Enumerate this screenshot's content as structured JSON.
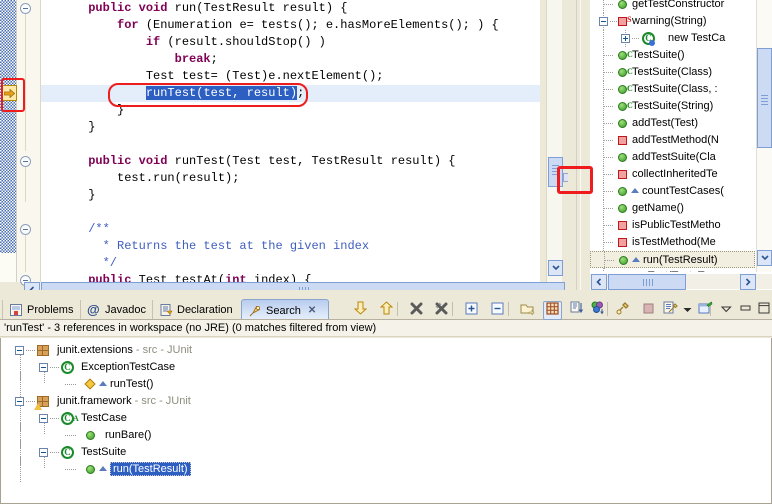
{
  "editor": {
    "name": "java-source-editor",
    "lines": [
      {
        "indent": 3,
        "segments": [
          {
            "t": "public",
            "c": "kw"
          },
          {
            "t": " ",
            "c": ""
          },
          {
            "t": "void",
            "c": "kw"
          },
          {
            "t": " run(TestResult result) {",
            "c": ""
          }
        ]
      },
      {
        "indent": 5,
        "segments": [
          {
            "t": "for",
            "c": "kw"
          },
          {
            "t": " (Enumeration e= tests(); e.hasMoreElements(); ) {",
            "c": ""
          }
        ]
      },
      {
        "indent": 7,
        "segments": [
          {
            "t": "if",
            "c": "kw"
          },
          {
            "t": " (result.shouldStop() )",
            "c": ""
          }
        ]
      },
      {
        "indent": 9,
        "segments": [
          {
            "t": "break",
            "c": "kw"
          },
          {
            "t": ";",
            "c": ""
          }
        ]
      },
      {
        "indent": 7,
        "segments": [
          {
            "t": "Test test= (Test)e.nextElement();",
            "c": ""
          }
        ]
      },
      {
        "indent": 7,
        "segments": [
          {
            "t": "runTest(test, result)",
            "c": "sel"
          },
          {
            "t": ";",
            "c": ""
          }
        ]
      },
      {
        "indent": 5,
        "segments": [
          {
            "t": "}",
            "c": ""
          }
        ]
      },
      {
        "indent": 3,
        "segments": [
          {
            "t": "}",
            "c": ""
          }
        ]
      },
      {
        "indent": 0,
        "segments": []
      },
      {
        "indent": 3,
        "segments": [
          {
            "t": "public",
            "c": "kw"
          },
          {
            "t": " ",
            "c": ""
          },
          {
            "t": "void",
            "c": "kw"
          },
          {
            "t": " runTest(Test test, TestResult result) {",
            "c": ""
          }
        ]
      },
      {
        "indent": 5,
        "segments": [
          {
            "t": "test.run(result);",
            "c": ""
          }
        ]
      },
      {
        "indent": 3,
        "segments": [
          {
            "t": "}",
            "c": ""
          }
        ]
      },
      {
        "indent": 0,
        "segments": []
      },
      {
        "indent": 3,
        "segments": [
          {
            "t": "/**",
            "c": "cm"
          }
        ]
      },
      {
        "indent": 4,
        "segments": [
          {
            "t": "* Returns the test at the given index",
            "c": "cm"
          }
        ]
      },
      {
        "indent": 4,
        "segments": [
          {
            "t": "*/",
            "c": "cm"
          }
        ]
      },
      {
        "indent": 3,
        "segments": [
          {
            "t": "public",
            "c": "kw"
          },
          {
            "t": " Test testAt(",
            "c": ""
          },
          {
            "t": "int",
            "c": "kw"
          },
          {
            "t": " index) {",
            "c": ""
          }
        ]
      }
    ],
    "highlighted_line_index": 5,
    "annotation_oval": "red-oval-around-runTest-call",
    "overview_ruler_marker": "yellow-arrow-marker",
    "annotation_marker_box": "red-box-around-arrow-marker",
    "annotation_scrollbar_box": "red-box-near-vertical-scrollbar"
  },
  "outline": {
    "name": "outline-view",
    "items": [
      {
        "label": "getTestConstructor",
        "icon": "green-ball",
        "badge": "",
        "depth": 1,
        "expander": "",
        "partial": true
      },
      {
        "label": "warning(String)",
        "icon": "red-square",
        "badge": "S",
        "depth": 1,
        "expander": "minus"
      },
      {
        "label": "new TestCa",
        "icon": "green-class",
        "badge": "",
        "depth": 2,
        "expander": "plus"
      },
      {
        "label": "TestSuite()",
        "icon": "green-ball",
        "badge": "C",
        "depth": 1,
        "expander": ""
      },
      {
        "label": "TestSuite(Class)",
        "icon": "green-ball",
        "badge": "C",
        "depth": 1,
        "expander": ""
      },
      {
        "label": "TestSuite(Class, :",
        "icon": "green-ball",
        "badge": "C",
        "depth": 1,
        "expander": ""
      },
      {
        "label": "TestSuite(String)",
        "icon": "green-ball",
        "badge": "C",
        "depth": 1,
        "expander": ""
      },
      {
        "label": "addTest(Test)",
        "icon": "green-ball",
        "badge": "",
        "depth": 1,
        "expander": ""
      },
      {
        "label": "addTestMethod(N",
        "icon": "red-square",
        "badge": "",
        "depth": 1,
        "expander": ""
      },
      {
        "label": "addTestSuite(Cla",
        "icon": "green-ball",
        "badge": "",
        "depth": 1,
        "expander": ""
      },
      {
        "label": "collectInheritedTe",
        "icon": "red-square",
        "badge": "",
        "depth": 1,
        "expander": ""
      },
      {
        "label": "countTestCases(",
        "icon": "green-ball",
        "badge": "",
        "depth": 1,
        "expander": "",
        "overrides": true
      },
      {
        "label": "getName()",
        "icon": "green-ball",
        "badge": "",
        "depth": 1,
        "expander": ""
      },
      {
        "label": "isPublicTestMetho",
        "icon": "red-square",
        "badge": "",
        "depth": 1,
        "expander": ""
      },
      {
        "label": "isTestMethod(Me",
        "icon": "red-square",
        "badge": "",
        "depth": 1,
        "expander": ""
      },
      {
        "label": "run(TestResult)",
        "icon": "green-ball",
        "badge": "",
        "depth": 1,
        "expander": "",
        "overrides": true,
        "selected": true
      },
      {
        "label": "runTest(Test, Te:",
        "icon": "green-ball",
        "badge": "",
        "depth": 1,
        "expander": ""
      }
    ]
  },
  "bottom_view": {
    "tabs": [
      {
        "label": "Problems",
        "icon": "problems-icon",
        "active": false
      },
      {
        "label": "Javadoc",
        "icon": "javadoc-icon",
        "active": false
      },
      {
        "label": "Declaration",
        "icon": "declaration-icon",
        "active": false
      },
      {
        "label": "Search",
        "icon": "search-icon",
        "active": true,
        "closable": true
      }
    ],
    "toolbar": [
      {
        "name": "show-next-match-button",
        "icon": "down-arrow-icon"
      },
      {
        "name": "show-previous-match-button",
        "icon": "up-arrow-icon"
      },
      {
        "name": "remove-selected-matches-button",
        "icon": "remove-match-icon"
      },
      {
        "name": "remove-all-matches-button",
        "icon": "remove-all-matches-icon"
      },
      {
        "name": "expand-all-button",
        "icon": "expand-all-icon"
      },
      {
        "name": "collapse-all-button",
        "icon": "collapse-all-icon"
      },
      {
        "name": "previous-search-button",
        "icon": "open-folder-icon"
      },
      {
        "name": "group-by-button",
        "icon": "table-grid-icon",
        "pressed": true
      },
      {
        "name": "sort-button",
        "icon": "sort-icon"
      },
      {
        "name": "filters-button",
        "icon": "filters-icon"
      },
      {
        "name": "run-search-button",
        "icon": "wrench-icon"
      },
      {
        "name": "cancel-search-button",
        "icon": "stop-icon"
      },
      {
        "name": "search-history-button",
        "icon": "search-history-icon"
      },
      {
        "name": "search-history-dropdown",
        "icon": "chevron-down-icon"
      },
      {
        "name": "pin-search-view-button",
        "icon": "pin-icon"
      },
      {
        "name": "view-menu-button",
        "icon": "view-menu-icon"
      },
      {
        "name": "minimize-view-button",
        "icon": "minimize-icon"
      },
      {
        "name": "maximize-view-button",
        "icon": "maximize-icon"
      }
    ],
    "status_text": "'runTest' - 3 references in workspace (no JRE) (0 matches filtered from view)",
    "results": [
      {
        "depth": 0,
        "label": "junit.extensions",
        "suffix": "- src - JUnit",
        "icon": "package-icon",
        "expander": "minus"
      },
      {
        "depth": 1,
        "label": "ExceptionTestCase",
        "suffix": "",
        "icon": "class-icon",
        "expander": "minus"
      },
      {
        "depth": 2,
        "label": "runTest()",
        "suffix": "",
        "icon": "diamond-icon",
        "expander": "",
        "overrides": true
      },
      {
        "depth": 0,
        "label": "junit.framework",
        "suffix": "- src - JUnit",
        "icon": "package-icon-warning",
        "expander": "minus"
      },
      {
        "depth": 1,
        "label": "TestCase",
        "suffix": "",
        "icon": "class-icon-abstract",
        "expander": "minus"
      },
      {
        "depth": 2,
        "label": "runBare()",
        "suffix": "",
        "icon": "method-icon",
        "expander": ""
      },
      {
        "depth": 1,
        "label": "TestSuite",
        "suffix": "",
        "icon": "class-icon",
        "expander": "minus"
      },
      {
        "depth": 2,
        "label": "run(TestResult)",
        "suffix": "",
        "icon": "method-icon",
        "expander": "",
        "overrides": true,
        "selected": true
      }
    ]
  },
  "colors": {
    "keyword": "#7f0055",
    "comment": "#3f5fbf",
    "selection": "#2d5fc3",
    "highlight_line": "#e4eefb",
    "annotation_red": "#ee1c1c",
    "chrome": "#ece9d8"
  }
}
